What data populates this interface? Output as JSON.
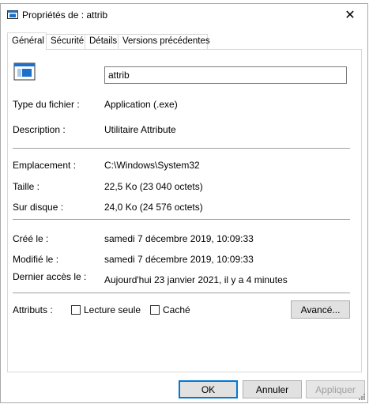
{
  "window": {
    "title": "Propriétés de : attrib",
    "close_glyph": "✕"
  },
  "tabs": [
    {
      "label": "Général",
      "active": true
    },
    {
      "label": "Sécurité",
      "active": false
    },
    {
      "label": "Détails",
      "active": false
    },
    {
      "label": "Versions précédentes",
      "active": false
    }
  ],
  "general": {
    "file_name": "attrib",
    "fields": {
      "file_type": {
        "label": "Type du fichier :",
        "value": "Application (.exe)"
      },
      "description": {
        "label": "Description :",
        "value": "Utilitaire Attribute"
      },
      "location": {
        "label": "Emplacement :",
        "value": "C:\\Windows\\System32"
      },
      "size": {
        "label": "Taille :",
        "value": "22,5 Ko (23 040 octets)"
      },
      "size_on_disk": {
        "label": "Sur disque :",
        "value": "24,0 Ko (24 576 octets)"
      },
      "created": {
        "label": "Créé le :",
        "value": "samedi 7 décembre 2019, 10:09:33"
      },
      "modified": {
        "label": "Modifié le :",
        "value": "samedi 7 décembre 2019, 10:09:33"
      },
      "accessed": {
        "label": "Dernier accès le :",
        "value": "Aujourd'hui 23 janvier 2021, il y a 4 minutes"
      }
    },
    "attributes": {
      "label": "Attributs :",
      "read_only": {
        "label": "Lecture seule",
        "checked": false
      },
      "hidden": {
        "label": "Caché",
        "checked": false
      },
      "advanced_button": "Avancé..."
    }
  },
  "footer": {
    "ok": "OK",
    "cancel": "Annuler",
    "apply": "Appliquer"
  },
  "colors": {
    "accent": "#0078d7",
    "button_bg": "#e1e1e1",
    "border": "#d9d9d9",
    "disabled_text": "#a0a0a0"
  }
}
